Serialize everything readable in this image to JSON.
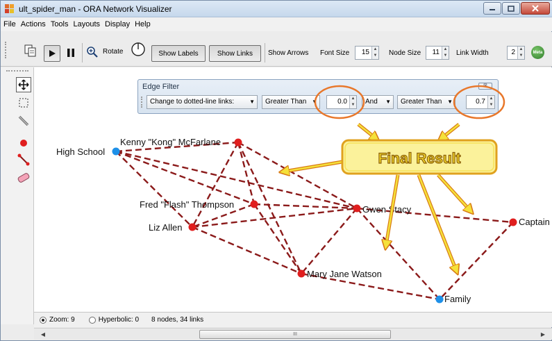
{
  "window": {
    "title": "ult_spider_man - ORA Network Visualizer",
    "controls": [
      "minimize-icon",
      "maximize-icon",
      "close-icon"
    ]
  },
  "menu": [
    "File",
    "Actions",
    "Tools",
    "Layouts",
    "Display",
    "Help"
  ],
  "toolbar": {
    "rotate_label": "Rotate",
    "show_labels": "Show Labels",
    "show_links": "Show Links",
    "show_arrows": "Show Arrows",
    "font_size_label": "Font Size",
    "font_size_value": "15",
    "node_size_label": "Node Size",
    "node_size_value": "11",
    "link_width_label": "Link Width",
    "link_width_value": "2",
    "meta_label": "Meta"
  },
  "edge_filter": {
    "title": "Edge Filter",
    "action": "Change to dotted-line links:",
    "condition1": "Greater Than",
    "value1": "0.0",
    "join": "And",
    "condition2": "Greater Than",
    "value2": "0.7"
  },
  "annotation": {
    "callout": "Final Result",
    "accent": "#f5e13a",
    "highlight_ring": "#e8772a"
  },
  "graph": {
    "link_color": "#8b1a1a",
    "agent_color": "#e01e1e",
    "org_color": "#1e90e8",
    "nodes": [
      {
        "id": "high-school",
        "label": "High School",
        "type": "org"
      },
      {
        "id": "kenny",
        "label": "Kenny \"Kong\" McFarlane",
        "type": "agent"
      },
      {
        "id": "flash",
        "label": "Fred \"Flash\" Thompson",
        "type": "agent"
      },
      {
        "id": "liz",
        "label": "Liz Allen",
        "type": "agent"
      },
      {
        "id": "gwen",
        "label": "Gwen Stacy",
        "type": "agent"
      },
      {
        "id": "mj",
        "label": "Mary Jane Watson",
        "type": "agent"
      },
      {
        "id": "captain",
        "label": "Captain",
        "type": "agent"
      },
      {
        "id": "family",
        "label": "Family",
        "type": "org"
      }
    ]
  },
  "status": {
    "zoom": "Zoom: 9",
    "hyperbolic": "Hyperbolic: 0",
    "summary": "8 nodes, 34 links"
  },
  "scrollbar": {
    "thumb_grip": "III"
  }
}
